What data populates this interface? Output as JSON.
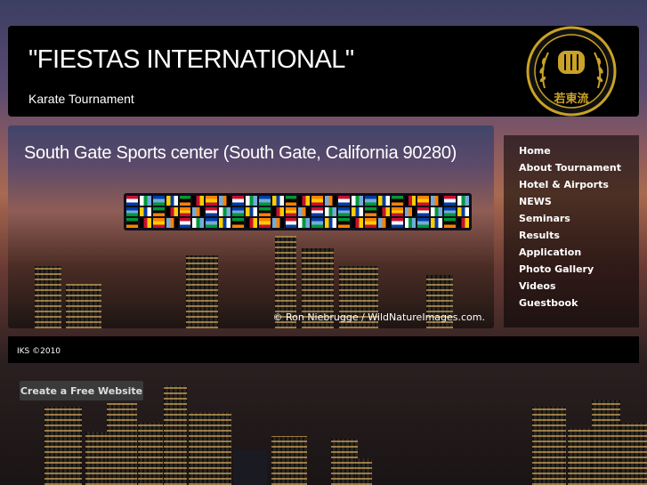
{
  "header": {
    "title": "\"FIESTAS INTERNATIONAL\"",
    "slogan": "Karate Tournament",
    "logo_icon": "karate-fist-emblem-icon",
    "logo_glyphs": "若東流"
  },
  "banner": {
    "title": "South Gate Sports center (South Gate, California 90280)",
    "flags_icon": "world-flags-strip",
    "credit": "© Ron Niebrugge / WildNatureImages.com."
  },
  "nav": {
    "items": [
      {
        "label": "Home"
      },
      {
        "label": "About Tournament"
      },
      {
        "label": "Hotel & Airports"
      },
      {
        "label": "NEWS"
      },
      {
        "label": "Seminars"
      },
      {
        "label": "Results"
      },
      {
        "label": "Application"
      },
      {
        "label": "Photo Gallery"
      },
      {
        "label": "Videos"
      },
      {
        "label": "Guestbook"
      }
    ]
  },
  "footer": {
    "text": "IKS ©2010"
  },
  "cta": {
    "label": "Create a Free Website"
  },
  "colors": {
    "header_bg": "#000000",
    "text": "#ffffff",
    "logo_gold": "#c9a227",
    "cta_bg": "#3a3a3a"
  }
}
